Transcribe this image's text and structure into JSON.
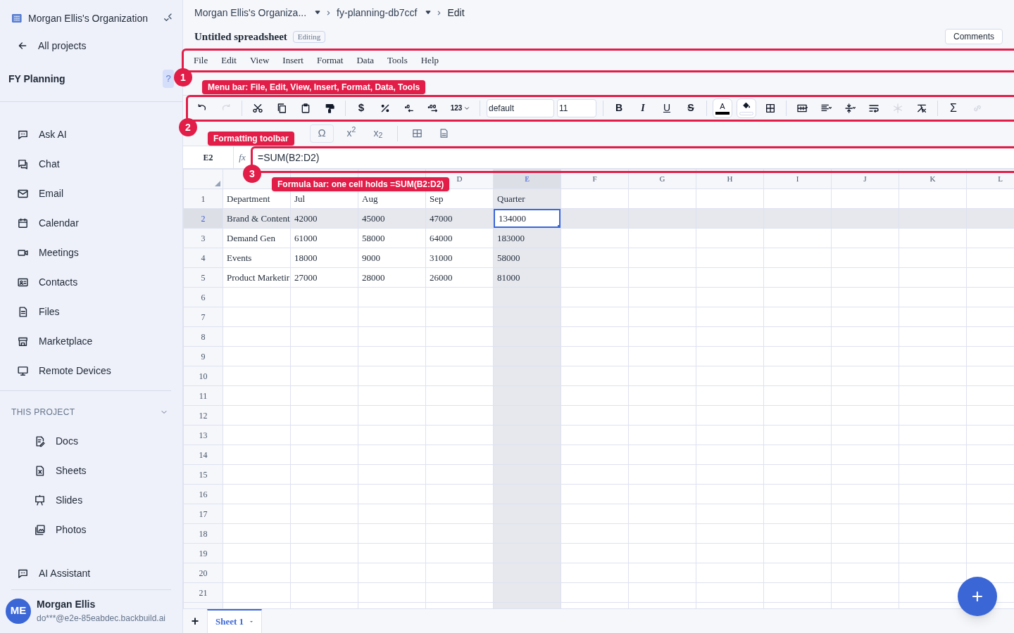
{
  "sidebar": {
    "organization": "Morgan Ellis's Organization",
    "back_link": "All projects",
    "project": "FY Planning",
    "help": "?",
    "items": [
      {
        "label": "Ask AI"
      },
      {
        "label": "Chat"
      },
      {
        "label": "Email"
      },
      {
        "label": "Calendar"
      },
      {
        "label": "Meetings"
      },
      {
        "label": "Contacts"
      },
      {
        "label": "Files"
      },
      {
        "label": "Marketplace"
      },
      {
        "label": "Remote Devices"
      }
    ],
    "section": {
      "title": "THIS PROJECT",
      "expanded": true,
      "items": [
        {
          "label": "Docs"
        },
        {
          "label": "Sheets"
        },
        {
          "label": "Slides"
        },
        {
          "label": "Photos"
        }
      ]
    },
    "assistant": "AI Assistant",
    "user": {
      "initials": "ME",
      "name": "Morgan Ellis",
      "email": "do***@e2e-85eabdec.backbuild.ai"
    }
  },
  "breadcrumb": [
    {
      "label": "Morgan Ellis's Organiza...",
      "dropdown": true
    },
    {
      "label": "fy-planning-db7ccf",
      "dropdown": true
    },
    {
      "label": "Edit",
      "dropdown": false
    }
  ],
  "document": {
    "title": "Untitled spreadsheet",
    "status": "Editing",
    "comments_button": "Comments"
  },
  "menu": [
    "File",
    "Edit",
    "View",
    "Insert",
    "Format",
    "Data",
    "Tools",
    "Help"
  ],
  "toolbar": [
    {
      "kind": "undo",
      "disabled": false
    },
    {
      "kind": "redo",
      "disabled": true
    },
    {
      "kind": "separator"
    },
    {
      "kind": "cut",
      "disabled": false
    },
    {
      "kind": "copy",
      "disabled": false
    },
    {
      "kind": "paste",
      "disabled": false
    },
    {
      "kind": "paint",
      "disabled": false
    },
    {
      "kind": "separator"
    },
    {
      "kind": "currency",
      "label": "$",
      "disabled": false
    },
    {
      "kind": "percent",
      "disabled": false
    },
    {
      "kind": "decimal-less",
      "disabled": false
    },
    {
      "kind": "decimal-more",
      "disabled": false
    },
    {
      "kind": "number-format",
      "label": "123",
      "disabled": false
    },
    {
      "kind": "separator"
    },
    {
      "kind": "font-field",
      "value": "default"
    },
    {
      "kind": "size-field",
      "value": "11"
    },
    {
      "kind": "separator"
    },
    {
      "kind": "bold",
      "label": "B",
      "disabled": false
    },
    {
      "kind": "italic",
      "label": "I",
      "disabled": false
    },
    {
      "kind": "underline",
      "label": "U",
      "disabled": false
    },
    {
      "kind": "strike",
      "label": "S",
      "disabled": false
    },
    {
      "kind": "separator"
    },
    {
      "kind": "text-color",
      "label": "A",
      "color": "#000000",
      "disabled": false
    },
    {
      "kind": "fill-color",
      "disabled": false
    },
    {
      "kind": "borders",
      "disabled": false
    },
    {
      "kind": "separator"
    },
    {
      "kind": "merge",
      "disabled": false
    },
    {
      "kind": "align",
      "disabled": false
    },
    {
      "kind": "valign",
      "disabled": false
    },
    {
      "kind": "wrap",
      "disabled": false
    },
    {
      "kind": "freeze",
      "disabled": true
    },
    {
      "kind": "clear",
      "disabled": false
    },
    {
      "kind": "separator"
    },
    {
      "kind": "sum",
      "label": "Σ",
      "disabled": false
    },
    {
      "kind": "link",
      "disabled": true
    }
  ],
  "toolbar_row_2": [
    {
      "kind": "symbol",
      "label": "Ω"
    },
    {
      "kind": "superscript",
      "label": "x$^{2}$"
    },
    {
      "kind": "subscript",
      "label": "x$_{2}$"
    }
  ],
  "formula_bar": {
    "cell": "E2",
    "fx": "fx",
    "formula": "=SUM(B2:D2)"
  },
  "column_headers": [
    {
      "label": "D",
      "selected": false
    },
    {
      "label": "E",
      "selected": true
    },
    {
      "label": "F",
      "selected": false
    },
    {
      "label": "G",
      "selected": false
    },
    {
      "label": "H",
      "selected": false
    },
    {
      "label": "I",
      "selected": false
    },
    {
      "label": "J",
      "selected": false
    },
    {
      "label": "K",
      "selected": false
    },
    {
      "label": "L",
      "selected": false
    }
  ],
  "rows": [
    {
      "number": "1",
      "selected": false,
      "cells": [
        {
          "text": "Department",
          "selected": false
        },
        {
          "text": "Jul",
          "selected": false
        },
        {
          "text": "Aug",
          "selected": false
        },
        {
          "text": "Sep",
          "selected": false
        },
        {
          "text": "Quarter",
          "selected": false
        }
      ]
    },
    {
      "number": "2",
      "selected": true,
      "cells": [
        {
          "text": "Brand & Content",
          "selected": false
        },
        {
          "text": "42000",
          "selected": false
        },
        {
          "text": "45000",
          "selected": false
        },
        {
          "text": "47000",
          "selected": false
        },
        {
          "text": "134000",
          "selected": true
        }
      ]
    },
    {
      "number": "3",
      "selected": false,
      "cells": [
        {
          "text": "Demand Gen",
          "selected": false
        },
        {
          "text": "61000",
          "selected": false
        },
        {
          "text": "58000",
          "selected": false
        },
        {
          "text": "64000",
          "selected": false
        },
        {
          "text": "183000",
          "selected": false
        }
      ]
    },
    {
      "number": "4",
      "selected": false,
      "cells": [
        {
          "text": "Events",
          "selected": false
        },
        {
          "text": "18000",
          "selected": false
        },
        {
          "text": "9000",
          "selected": false
        },
        {
          "text": "31000",
          "selected": false
        },
        {
          "text": "58000",
          "selected": false
        }
      ]
    },
    {
      "number": "5",
      "selected": false,
      "cells": [
        {
          "text": "Product Marketir",
          "selected": false
        },
        {
          "text": "27000",
          "selected": false
        },
        {
          "text": "28000",
          "selected": false
        },
        {
          "text": "26000",
          "selected": false
        },
        {
          "text": "81000",
          "selected": false
        }
      ]
    },
    {
      "number": "6",
      "selected": false
    },
    {
      "number": "7",
      "selected": false
    },
    {
      "number": "8",
      "selected": false
    },
    {
      "number": "9",
      "selected": false
    },
    {
      "number": "10",
      "selected": false
    },
    {
      "number": "11",
      "selected": false
    },
    {
      "number": "12",
      "selected": false
    },
    {
      "number": "13",
      "selected": false
    },
    {
      "number": "14",
      "selected": false
    },
    {
      "number": "15",
      "selected": false
    },
    {
      "number": "16",
      "selected": false
    },
    {
      "number": "17",
      "selected": false
    },
    {
      "number": "18",
      "selected": false
    },
    {
      "number": "19",
      "selected": false
    },
    {
      "number": "20",
      "selected": false
    },
    {
      "number": "21",
      "selected": false
    }
  ],
  "sheet_tabs": {
    "add": "+",
    "tabs": [
      {
        "label": "Sheet 1",
        "selected": true
      }
    ]
  },
  "annotations": [
    {
      "number": "1",
      "label": "Menu bar: File, Edit, View, Insert, Format, Data, Tools"
    },
    {
      "number": "2",
      "label": "Formatting toolbar"
    },
    {
      "number": "3",
      "label": "Formula bar: one cell holds =SUM(B2:D2)"
    }
  ],
  "fab": "+"
}
